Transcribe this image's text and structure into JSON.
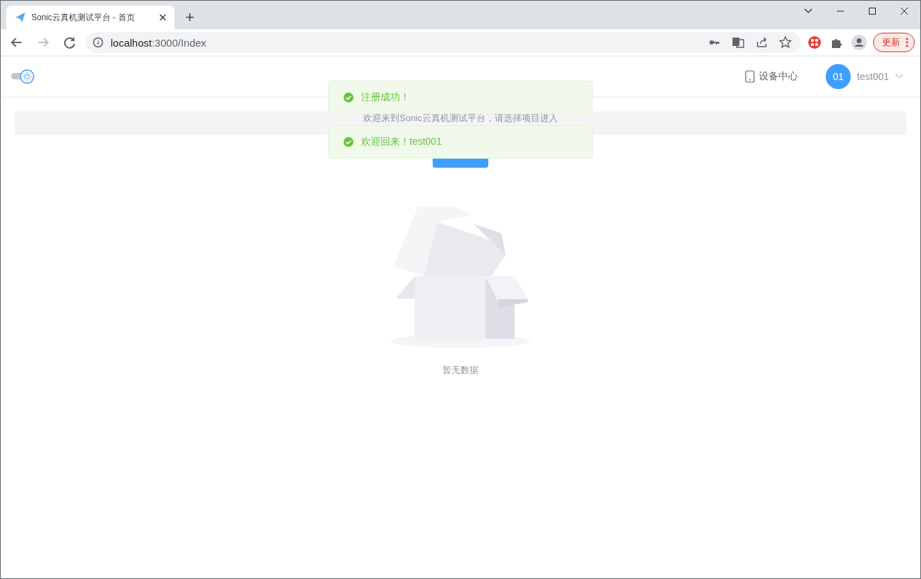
{
  "browser": {
    "tabs": [
      {
        "title": "Sonic云真机测试平台 - 首页",
        "selected": true
      }
    ],
    "new_tab": "+",
    "address": {
      "host": "localhost",
      "path": ":3000/Index"
    },
    "update_button": "更新"
  },
  "header": {
    "theme_switch": {
      "on": true
    },
    "nav_link": "设备中心",
    "user": {
      "avatar": "01",
      "name": "test001"
    }
  },
  "banner": "欢迎来到Sonic云真机测试平台，请选择项目进入",
  "empty": {
    "text": "暂无数据"
  },
  "toasts": [
    {
      "kind": "success",
      "text": "注册成功！"
    },
    {
      "kind": "success",
      "text": "欢迎回来！test001"
    }
  ]
}
